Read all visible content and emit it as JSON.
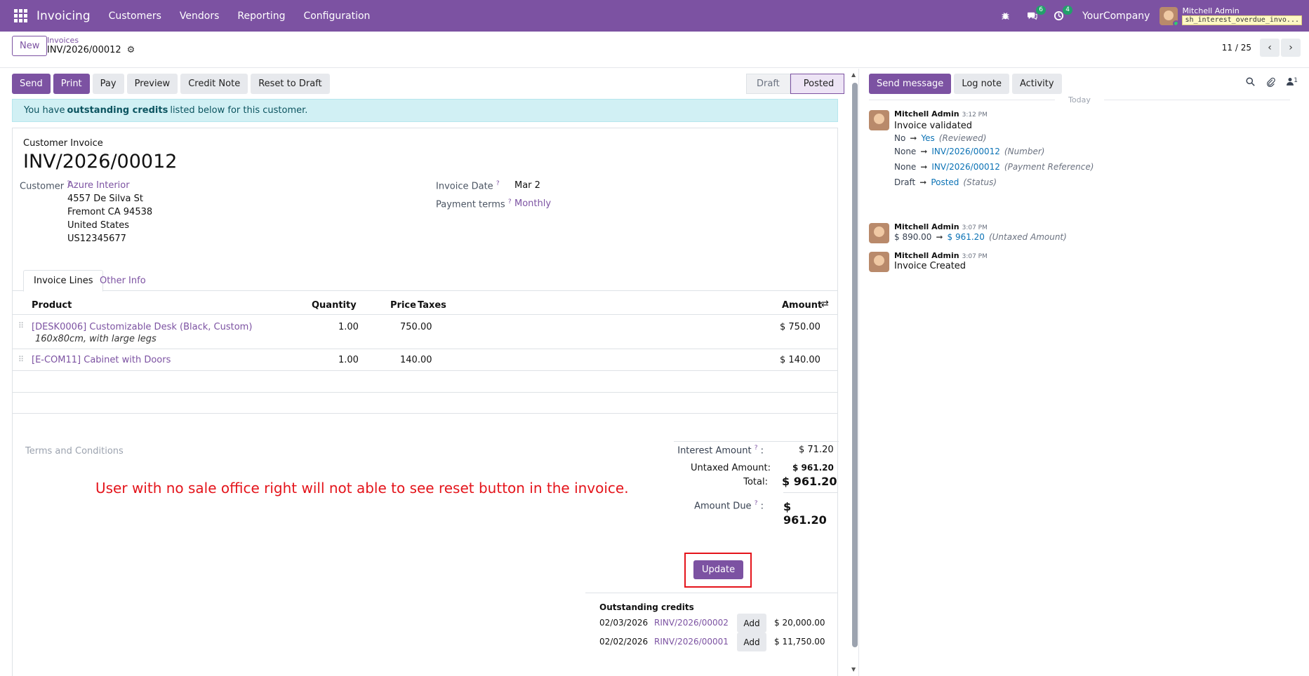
{
  "navbar": {
    "app_name": "Invoicing",
    "menus": [
      "Customers",
      "Vendors",
      "Reporting",
      "Configuration"
    ],
    "messages_badge": "6",
    "activities_badge": "4",
    "company": "YourCompany",
    "user_name": "Mitchell Admin",
    "database": "sh_interest_overdue_invo..."
  },
  "control": {
    "new_label": "New",
    "breadcrumb_parent": "Invoices",
    "breadcrumb_current": "INV/2026/00012",
    "pager_value": "11 / 25"
  },
  "actions": {
    "send": "Send",
    "print": "Print",
    "pay": "Pay",
    "preview": "Preview",
    "credit_note": "Credit Note",
    "reset_to_draft": "Reset to Draft"
  },
  "status": {
    "draft": "Draft",
    "posted": "Posted",
    "current": "Posted"
  },
  "alert": {
    "prefix": "You have",
    "bold": "outstanding credits",
    "suffix": "listed below for this customer."
  },
  "invoice": {
    "type": "Customer Invoice",
    "number": "INV/2026/00012",
    "customer_label": "Customer",
    "customer_name": "Azure Interior",
    "address": [
      "4557 De Silva St",
      "Fremont CA 94538",
      "United States",
      "US12345677"
    ],
    "date_label": "Invoice Date",
    "date_value": "Mar 2",
    "terms_label": "Payment terms",
    "terms_value": "Monthly"
  },
  "tabs": {
    "invoice_lines": "Invoice Lines",
    "other_info": "Other Info"
  },
  "lines": {
    "headers": {
      "product": "Product",
      "quantity": "Quantity",
      "price": "Price",
      "taxes": "Taxes",
      "amount": "Amount"
    },
    "rows": [
      {
        "product": "[DESK0006] Customizable Desk (Black, Custom)",
        "description": "160x80cm, with large legs",
        "quantity": "1.00",
        "price": "750.00",
        "amount": "$ 750.00"
      },
      {
        "product": "[E-COM11] Cabinet with Doors",
        "description": "",
        "quantity": "1.00",
        "price": "140.00",
        "amount": "$ 140.00"
      }
    ]
  },
  "terms_placeholder": "Terms and Conditions",
  "annotation": "User with no sale office right will not able to see reset button in the invoice.",
  "totals": {
    "interest_label": "Interest Amount",
    "interest_value": "$ 71.20",
    "untaxed_label": "Untaxed Amount:",
    "untaxed_value": "$ 961.20",
    "total_label": "Total:",
    "total_value": "$ 961.20",
    "due_label": "Amount Due",
    "due_value": "$ 961.20",
    "update_label": "Update"
  },
  "credits": {
    "title": "Outstanding credits",
    "add_label": "Add",
    "rows": [
      {
        "date": "02/03/2026",
        "ref": "RINV/2026/00002",
        "amount": "$ 20,000.00"
      },
      {
        "date": "02/02/2026",
        "ref": "RINV/2026/00001",
        "amount": "$ 11,750.00"
      }
    ]
  },
  "chatter": {
    "send_message": "Send message",
    "log_note": "Log note",
    "activity": "Activity",
    "followers_count": "1",
    "today": "Today",
    "messages": [
      {
        "author": "Mitchell Admin",
        "time": "3:12 PM",
        "body": "Invoice validated",
        "changes": [
          {
            "old": "No",
            "new": "Yes",
            "field": "(Reviewed)"
          },
          {
            "old": "None",
            "new": "INV/2026/00012",
            "field": "(Number)"
          },
          {
            "old": "None",
            "new": "INV/2026/00012",
            "field": "(Payment Reference)"
          },
          {
            "old": "Draft",
            "new": "Posted",
            "field": "(Status)"
          }
        ]
      },
      {
        "author": "Mitchell Admin",
        "time": "3:07 PM",
        "body": "",
        "changes": [
          {
            "old": "$ 890.00",
            "new": "$ 961.20",
            "field": "(Untaxed Amount)"
          }
        ]
      },
      {
        "author": "Mitchell Admin",
        "time": "3:07 PM",
        "body": "Invoice Created",
        "changes": []
      }
    ]
  }
}
